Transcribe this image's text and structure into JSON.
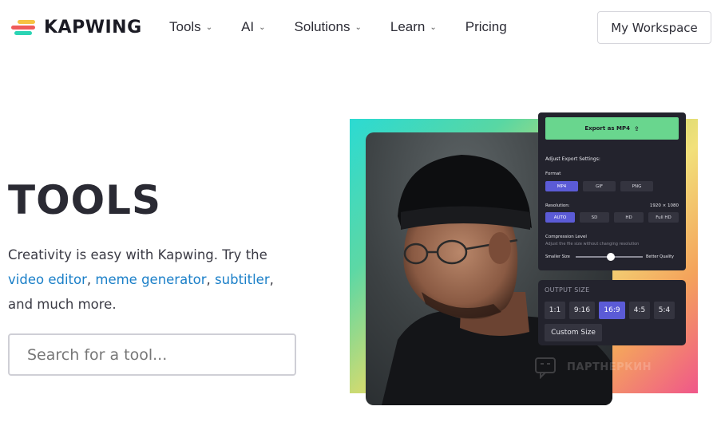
{
  "header": {
    "brand": "KAPWING",
    "nav": [
      {
        "label": "Tools",
        "has_dropdown": true
      },
      {
        "label": "AI",
        "has_dropdown": true
      },
      {
        "label": "Solutions",
        "has_dropdown": true
      },
      {
        "label": "Learn",
        "has_dropdown": true
      },
      {
        "label": "Pricing",
        "has_dropdown": false
      }
    ],
    "chevron": "⌄",
    "workspace_button": "My Workspace"
  },
  "hero": {
    "title": "TOOLS",
    "desc_prefix": "Creativity is easy with Kapwing. Try the",
    "link_video_editor": "video editor",
    "sep1": ", ",
    "link_meme_generator": "meme generator",
    "sep2": ", ",
    "link_subtitler": "subtitler",
    "sep3": ",",
    "desc_suffix": "and much more.",
    "search_placeholder": "Search for a tool..."
  },
  "export_panel": {
    "export_button": "Export as MP4",
    "export_icon": "share-icon",
    "settings_title": "Adjust Export Settings:",
    "format_label": "Format",
    "formats": [
      "MP4",
      "GIF",
      "PNG"
    ],
    "format_selected": "MP4",
    "resolution_label": "Resolution:",
    "resolution_value": "1920 × 1080",
    "resolutions": [
      "AUTO",
      "SD",
      "HD",
      "Full HD"
    ],
    "resolution_selected": "AUTO",
    "compression_label": "Compression Level",
    "compression_sub": "Adjust the file size without changing resolution",
    "slider_min_label": "Smaller Size",
    "slider_max_label": "Better Quality"
  },
  "output_panel": {
    "title": "OUTPUT SIZE",
    "sizes": [
      "1:1",
      "9:16",
      "16:9",
      "4:5",
      "5:4"
    ],
    "selected": "16:9",
    "custom_button": "Custom Size"
  },
  "watermark": "ПАРТНЕРКИН",
  "colors": {
    "accent": "#5b5bd6",
    "export_green": "#69d68e",
    "link": "#1a7fc8",
    "panel_bg": "#23232d"
  }
}
